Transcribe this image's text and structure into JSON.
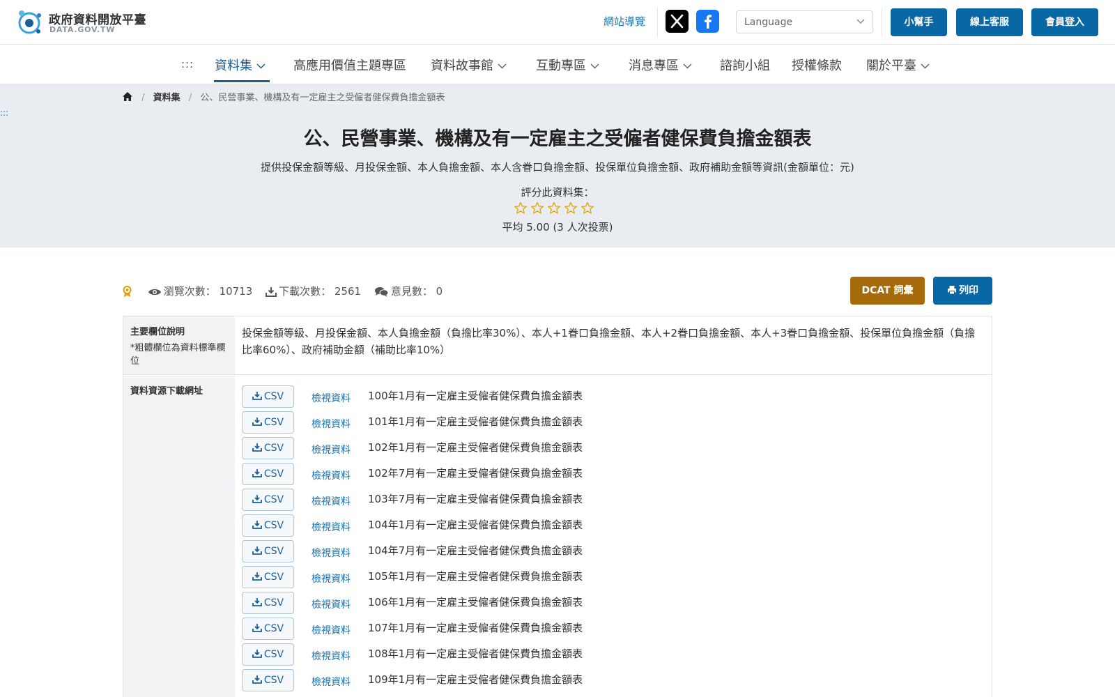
{
  "header": {
    "logo_title": "政府資料開放平臺",
    "logo_sub": "DATA.GOV.TW",
    "sitemap": "網站導覽",
    "language_placeholder": "Language",
    "buttons": [
      "小幫手",
      "線上客服",
      "會員登入"
    ]
  },
  "nav": {
    "accesskey": ":::",
    "items": [
      "資料集",
      "高應用價值主題專區",
      "資料故事館",
      "互動專區",
      "消息專區",
      "諮詢小組",
      "授權條款",
      "關於平臺"
    ]
  },
  "breadcrumb": {
    "home_icon": "home-icon",
    "items": [
      "資料集",
      "公、民營事業、機構及有一定雇主之受僱者健保費負擔金額表"
    ]
  },
  "hero": {
    "accesskey": ":::",
    "title": "公、民營事業、機構及有一定雇主之受僱者健保費負擔金額表",
    "description": "提供投保金額等級、月投保金額、本人負擔金額、本人含眷口負擔金額、投保單位負擔金額、政府補助金額等資訊(金額單位：元)",
    "rate_label": "評分此資料集：",
    "rating_stars_total": 5,
    "average_text": "平均 5.00 (3 人次投票)"
  },
  "stats": {
    "views_label": "瀏覽次數：",
    "views": "10713",
    "downloads_label": "下載次數：",
    "downloads": "2561",
    "comments_label": "意見數：",
    "comments": "0",
    "dcat_button": "DCAT 詞彙",
    "print_button": "列印"
  },
  "table": {
    "fields_label": "主要欄位說明",
    "fields_note": "*粗體欄位為資料標準欄位",
    "fields_value": "投保金額等級、月投保金額、本人負擔金額（負擔比率30%）、本人+1眷口負擔金額、本人+2眷口負擔金額、本人+3眷口負擔金額、投保單位負擔金額（負擔比率60%）、政府補助金額（補助比率10%）",
    "resources_label": "資料資源下載網址",
    "csv_label": "CSV",
    "view_label": "檢視資料",
    "resources": [
      "100年1月有一定雇主受僱者健保費負擔金額表",
      "101年1月有一定雇主受僱者健保費負擔金額表",
      "102年1月有一定雇主受僱者健保費負擔金額表",
      "102年7月有一定雇主受僱者健保費負擔金額表",
      "103年7月有一定雇主受僱者健保費負擔金額表",
      "104年1月有一定雇主受僱者健保費負擔金額表",
      "104年7月有一定雇主受僱者健保費負擔金額表",
      "105年1月有一定雇主受僱者健保費負擔金額表",
      "106年1月有一定雇主受僱者健保費負擔金額表",
      "107年1月有一定雇主受僱者健保費負擔金額表",
      "108年1月有一定雇主受僱者健保費負擔金額表",
      "109年1月有一定雇主受僱者健保費負擔金額表"
    ]
  },
  "colors": {
    "primary": "#0a67a6",
    "dcat": "#a66a0c",
    "hero_bg": "#e9edf2",
    "star": "#e2a300"
  }
}
